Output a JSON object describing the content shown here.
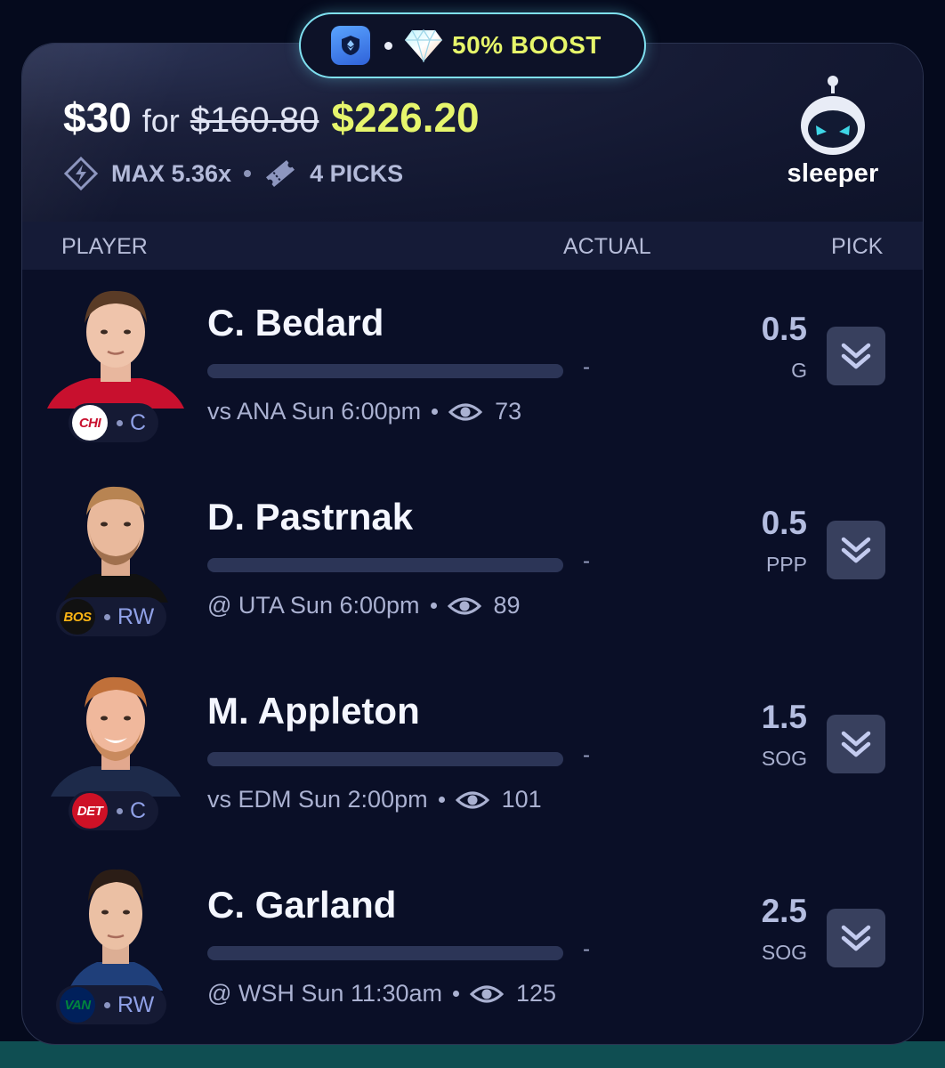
{
  "boost": {
    "dot": "•",
    "label": "50% BOOST"
  },
  "summary": {
    "stake": "$30",
    "for_word": "for",
    "old_payout": "$160.80",
    "new_payout": "$226.20",
    "max_multiplier": "MAX 5.36x",
    "picks_count": "4 PICKS"
  },
  "brand": {
    "name": "sleeper"
  },
  "columns": {
    "player": "PLAYER",
    "actual": "ACTUAL",
    "pick": "PICK"
  },
  "players": [
    {
      "name": "C. Bedard",
      "team": "CHI",
      "position": "C",
      "game": "vs ANA Sun 6:00pm",
      "views": "73",
      "actual": "-",
      "line": "0.5",
      "stat": "G",
      "team_color": "#ffffff",
      "team_text_color": "#c8102e",
      "jersey_color": "#c8102e"
    },
    {
      "name": "D. Pastrnak",
      "team": "BOS",
      "position": "RW",
      "game": "@ UTA Sun 6:00pm",
      "views": "89",
      "actual": "-",
      "line": "0.5",
      "stat": "PPP",
      "team_color": "#111111",
      "team_text_color": "#fcb514",
      "jersey_color": "#111111"
    },
    {
      "name": "M. Appleton",
      "team": "DET",
      "position": "C",
      "game": "vs EDM Sun 2:00pm",
      "views": "101",
      "actual": "-",
      "line": "1.5",
      "stat": "SOG",
      "team_color": "#ce1126",
      "team_text_color": "#ffffff",
      "jersey_color": "#1d2a4a"
    },
    {
      "name": "C. Garland",
      "team": "VAN",
      "position": "RW",
      "game": "@ WSH Sun 11:30am",
      "views": "125",
      "actual": "-",
      "line": "2.5",
      "stat": "SOG",
      "team_color": "#00205b",
      "team_text_color": "#00843d",
      "jersey_color": "#1f3f7a"
    }
  ]
}
